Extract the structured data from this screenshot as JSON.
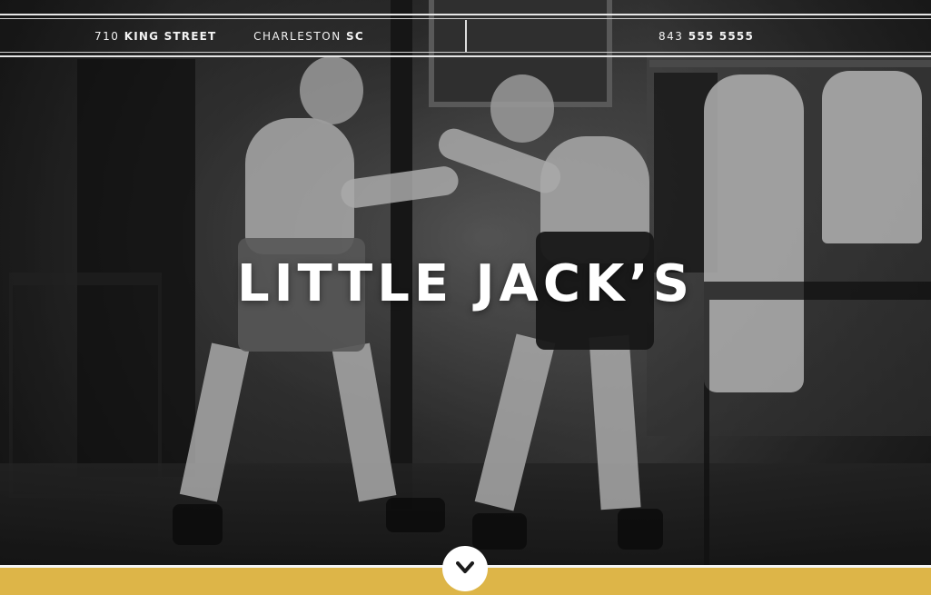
{
  "header": {
    "address_number": "710",
    "address_street": "KING STREET",
    "city": "CHARLESTON",
    "state": "SC",
    "phone_area": "843",
    "phone_main": "555 5555"
  },
  "hero": {
    "title": "LITTLE JACK’S",
    "scroll_icon": "chevron-down-icon"
  },
  "colors": {
    "accent_gold": "#ddb548",
    "text_light": "#ffffff"
  }
}
